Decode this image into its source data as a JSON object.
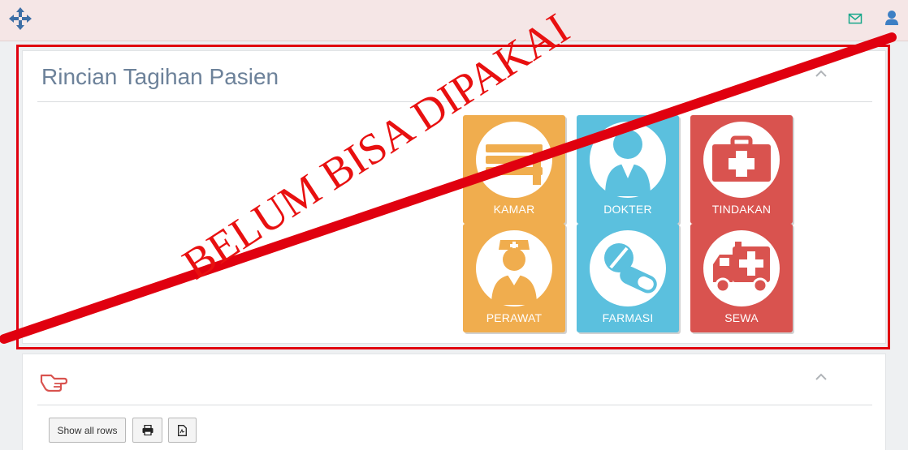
{
  "topbar": {
    "move_icon": "move-arrows-icon",
    "mail_icon": "envelope-icon",
    "user_icon": "user-icon"
  },
  "panel1": {
    "title": "Rincian Tagihan Pasien",
    "tiles": [
      {
        "label": "KAMAR",
        "icon": "bed-icon",
        "color": "#f0ad4e"
      },
      {
        "label": "DOKTER",
        "icon": "doctor-icon",
        "color": "#5bc0de"
      },
      {
        "label": "TINDAKAN",
        "icon": "first-aid-kit-icon",
        "color": "#d9534f"
      },
      {
        "label": "PERAWAT",
        "icon": "nurse-icon",
        "color": "#f0ad4e"
      },
      {
        "label": "FARMASI",
        "icon": "pills-icon",
        "color": "#5bc0de"
      },
      {
        "label": "SEWA",
        "icon": "ambulance-icon",
        "color": "#d9534f"
      }
    ]
  },
  "panel2": {
    "header_icon": "hand-pointer-icon",
    "buttons": {
      "show_all": "Show all rows",
      "print_icon": "print-icon",
      "pdf_icon": "pdf-file-icon"
    }
  },
  "stamp": {
    "text": "BELUM BISA DIPAKAI",
    "color": "#e0000f"
  }
}
